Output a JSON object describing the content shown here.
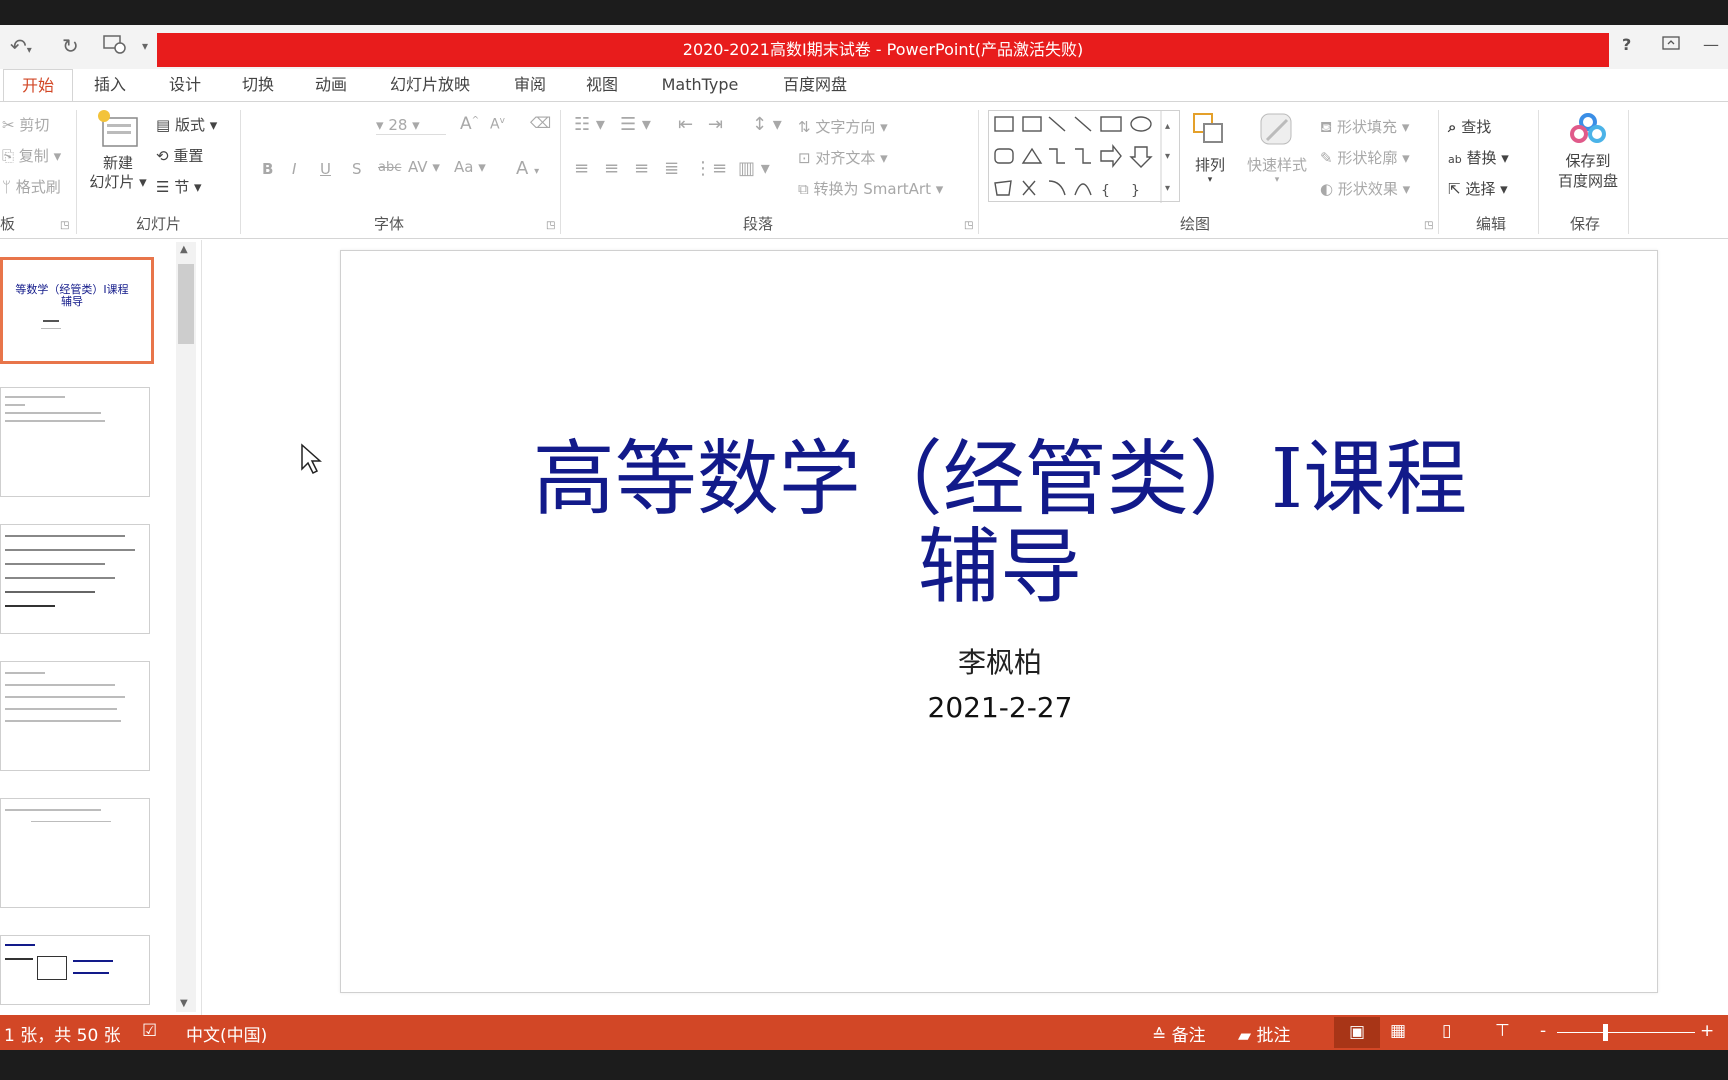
{
  "window": {
    "title": "2020-2021高数I期末试卷 -  PowerPoint(产品激活失败)",
    "help": "?",
    "colors": {
      "accent": "#d24726",
      "title_bar": "#e81c1c",
      "slide_title": "#121a8a"
    }
  },
  "tabs": [
    {
      "label": "开始",
      "active": true
    },
    {
      "label": "插入"
    },
    {
      "label": "设计"
    },
    {
      "label": "切换"
    },
    {
      "label": "动画"
    },
    {
      "label": "幻灯片放映"
    },
    {
      "label": "审阅"
    },
    {
      "label": "视图"
    },
    {
      "label": "MathType"
    },
    {
      "label": "百度网盘"
    }
  ],
  "ribbon": {
    "clipboard": {
      "cut": "剪切",
      "copy": "复制",
      "format_painter": "格式刷",
      "group": "板"
    },
    "slides": {
      "new_line1": "新建",
      "new_line2": "幻灯片",
      "layout": "版式",
      "reset": "重置",
      "section": "节",
      "group": "幻灯片"
    },
    "font": {
      "size": "28",
      "group": "字体",
      "bold": "B",
      "italic": "I",
      "underline": "U",
      "shadow": "S",
      "strike": "abc",
      "spacing": "AV",
      "case": "Aa",
      "color": "A"
    },
    "paragraph": {
      "text_direction": "文字方向",
      "align_text": "对齐文本",
      "smartart": "转换为 SmartArt",
      "group": "段落"
    },
    "drawing": {
      "arrange": "排列",
      "quick_styles": "快速样式",
      "fill": "形状填充",
      "outline": "形状轮廓",
      "effects": "形状效果",
      "group": "绘图"
    },
    "editing": {
      "find": "查找",
      "replace": "替换",
      "select": "选择",
      "group": "编辑"
    },
    "save": {
      "line1": "保存到",
      "line2": "百度网盘",
      "group": "保存"
    }
  },
  "thumbnail": {
    "title_line1": "等数学（经管类）I课程",
    "title_line2": "辅导"
  },
  "slide": {
    "title_line1": "高等数学（经管类）I课程",
    "title_line2": "辅导",
    "author": "李枫柏",
    "date": "2021-2-27"
  },
  "status": {
    "slide_count": "1 张，共 50 张",
    "language": "中文(中国)",
    "notes": "备注",
    "comments": "批注",
    "zoom_minus": "-",
    "zoom_plus": "+"
  }
}
